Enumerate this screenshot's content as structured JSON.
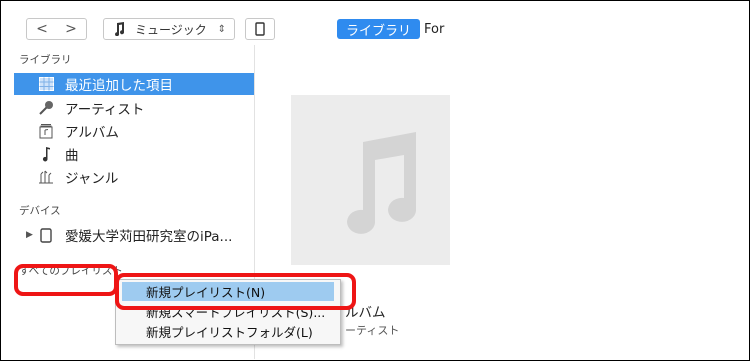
{
  "toolbar": {
    "back_glyph": "<",
    "forward_glyph": ">",
    "media_selector": "ミュージック",
    "tab_library": "ライブラリ",
    "tab_for": "For"
  },
  "sidebar": {
    "library_header": "ライブラリ",
    "library_items": [
      {
        "label": "最近追加した項目",
        "icon": "grid-icon"
      },
      {
        "label": "アーティスト",
        "icon": "microphone-icon"
      },
      {
        "label": "アルバム",
        "icon": "album-icon"
      },
      {
        "label": "曲",
        "icon": "music-note-icon"
      },
      {
        "label": "ジャンル",
        "icon": "genre-icon"
      }
    ],
    "devices_header": "デバイス",
    "device_name": "愛媛大学苅田研究室のiPa...",
    "playlists_header": "すべてのプレイリスト"
  },
  "content": {
    "album_name_partial": "ルバム",
    "album_artist_partial": "ーティスト"
  },
  "context_menu": {
    "items": [
      "新規プレイリスト(N)",
      "新規スマートプレイリスト(S)...",
      "新規プレイリストフォルダ(L)"
    ]
  },
  "colors": {
    "accent": "#2f8bef",
    "selected_row": "#3f94ea",
    "menu_hover": "#9ecbf0",
    "highlight": "#ee1515"
  }
}
